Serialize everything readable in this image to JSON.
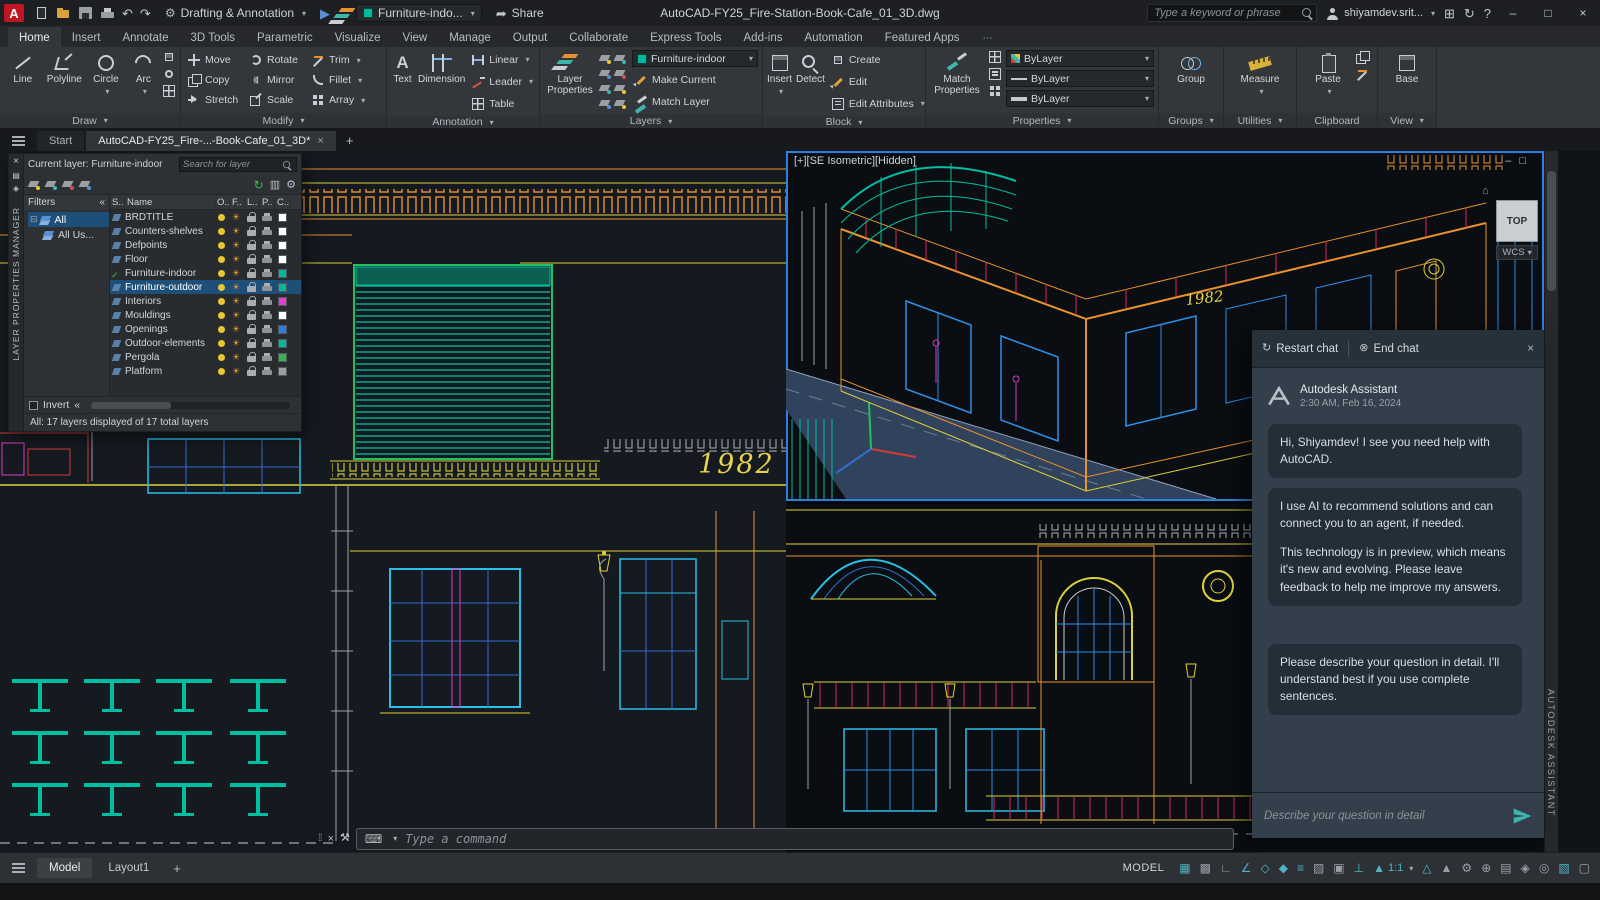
{
  "titlebar": {
    "workspace": "Drafting & Annotation",
    "quick_layer": "Furniture-indo...",
    "share": "Share",
    "doc_title": "AutoCAD-FY25_Fire-Station-Book-Cafe_01_3D.dwg",
    "search_placeholder": "Type a keyword or phrase",
    "account": "shiyamdev.srit..."
  },
  "ribbon": {
    "tabs": [
      "Home",
      "Insert",
      "Annotate",
      "3D Tools",
      "Parametric",
      "Visualize",
      "View",
      "Manage",
      "Output",
      "Collaborate",
      "Express Tools",
      "Add-ins",
      "Automation",
      "Featured Apps"
    ],
    "active_tab": "Home",
    "draw": {
      "line": "Line",
      "polyline": "Polyline",
      "circle": "Circle",
      "arc": "Arc",
      "label": "Draw"
    },
    "modify": {
      "move": "Move",
      "rotate": "Rotate",
      "trim": "Trim",
      "copy": "Copy",
      "mirror": "Mirror",
      "fillet": "Fillet",
      "stretch": "Stretch",
      "scale": "Scale",
      "array": "Array",
      "label": "Modify"
    },
    "annotation": {
      "text": "Text",
      "dimension": "Dimension",
      "linear": "Linear",
      "leader": "Leader",
      "table": "Table",
      "label": "Annotation"
    },
    "layers": {
      "layer_properties": "Layer Properties",
      "combo_value": "Furniture-indoor",
      "make_current": "Make Current",
      "match_layer": "Match Layer",
      "label": "Layers"
    },
    "block": {
      "insert": "Insert",
      "detect": "Detect",
      "create": "Create",
      "edit": "Edit",
      "edit_attributes": "Edit Attributes",
      "label": "Block"
    },
    "properties": {
      "match_properties": "Match Properties",
      "color_value": "ByLayer",
      "linetype_value": "ByLayer",
      "lineweight_value": "ByLayer",
      "label": "Properties"
    },
    "groups": {
      "group": "Group",
      "label": "Groups"
    },
    "utilities": {
      "measure": "Measure",
      "label": "Utilities"
    },
    "clipboard": {
      "paste": "Paste",
      "label": "Clipboard"
    },
    "view": {
      "base": "Base",
      "label": "View"
    }
  },
  "doc_tabs": {
    "start": "Start",
    "active": "AutoCAD-FY25_Fire-...-Book-Cafe_01_3D*"
  },
  "layer_palette": {
    "vertical_title": "LAYER PROPERTIES MANAGER",
    "current_layer": "Current layer: Furniture-indoor",
    "search_placeholder": "Search for layer",
    "filters_label": "Filters",
    "tree": [
      "All",
      "All Us..."
    ],
    "columns": [
      "S..",
      "Name",
      "O..",
      "F..",
      "L..",
      "P..",
      "C.."
    ],
    "rows": [
      {
        "name": "BRDTITLE",
        "color": "#ffffff"
      },
      {
        "name": "Counters-shelves",
        "color": "#ffffff"
      },
      {
        "name": "Defpoints",
        "color": "#ffffff"
      },
      {
        "name": "Floor",
        "color": "#ffffff"
      },
      {
        "name": "Furniture-indoor",
        "color": "#00b89c",
        "current": true
      },
      {
        "name": "Furniture-outdoor",
        "color": "#00b89c",
        "selected": true
      },
      {
        "name": "Interiors",
        "color": "#e13fd2"
      },
      {
        "name": "Mouldings",
        "color": "#ffffff"
      },
      {
        "name": "Openings",
        "color": "#2f7bdb"
      },
      {
        "name": "Outdoor-elements",
        "color": "#00b89c"
      },
      {
        "name": "Pergola",
        "color": "#35b44a"
      },
      {
        "name": "Platform",
        "color": "#9aa0a6"
      }
    ],
    "invert_label": "Invert",
    "status": "All: 17 layers displayed of 17 total layers"
  },
  "viewport": {
    "top_label": "[+][SE Isometric][Hidden]",
    "sign_text": "1982",
    "viewcube_top": "TOP",
    "wcs": "WCS"
  },
  "assistant": {
    "vertical_title": "AUTODESK ASSISTANT",
    "restart": "Restart chat",
    "end": "End chat",
    "bot_name": "Autodesk Assistant",
    "timestamp": "2:30 AM, Feb 16, 2024",
    "messages": [
      [
        "Hi, Shiyamdev! I see you need help with AutoCAD."
      ],
      [
        "I use AI to recommend solutions and can connect you to an agent, if needed.",
        "This technology is in preview, which means it's new and evolving. Please leave feedback to help me improve my answers."
      ],
      [
        "Please describe your question in detail. I'll understand best if you use complete sentences."
      ]
    ],
    "input_placeholder": "Describe your question in detail"
  },
  "command_line": {
    "placeholder": "Type a command"
  },
  "status_bar": {
    "model_tab": "Model",
    "layout_tab": "Layout1",
    "model_badge": "MODEL",
    "scale": "1:1",
    "icons_left": [
      {
        "name": "grid",
        "glyph": "▦",
        "on": true
      },
      {
        "name": "snap-mode",
        "glyph": "▩",
        "on": false
      },
      {
        "name": "ortho",
        "glyph": "∟",
        "on": false
      },
      {
        "name": "polar-tracking",
        "glyph": "∠",
        "on": true
      },
      {
        "name": "isodraft",
        "glyph": "◇",
        "on": true
      },
      {
        "name": "object-snap",
        "glyph": "◆",
        "on": true
      },
      {
        "name": "lineweight",
        "glyph": "≡",
        "on": true
      },
      {
        "name": "transparency",
        "glyph": "▨",
        "on": false
      },
      {
        "name": "selection-cycling",
        "glyph": "▣",
        "on": false
      },
      {
        "name": "dynamic-ucs",
        "glyph": "⊥",
        "on": true
      }
    ],
    "icons_right": [
      {
        "name": "annotation-visibility",
        "glyph": "△",
        "on": true
      },
      {
        "name": "autoscale",
        "glyph": "▲",
        "on": false
      },
      {
        "name": "workspace-switching",
        "glyph": "⚙",
        "on": false
      },
      {
        "name": "annotation-monitor",
        "glyph": "⊕",
        "on": false
      },
      {
        "name": "quick-properties",
        "glyph": "▤",
        "on": false
      },
      {
        "name": "lock-ui",
        "glyph": "◈",
        "on": false
      },
      {
        "name": "isolate-objects",
        "glyph": "◎",
        "on": false
      },
      {
        "name": "graphics-performance",
        "glyph": "▧",
        "on": true
      },
      {
        "name": "clean-screen",
        "glyph": "▢",
        "on": false
      }
    ]
  },
  "colors": {
    "accent_blue": "#2f7fe0",
    "teal": "#00bfa0",
    "yellow": "#ded23a",
    "orange": "#e8922e",
    "cyan": "#27c0e8",
    "blue": "#2f8fe8",
    "magenta": "#e038c8",
    "crimson": "#e0285a",
    "red": "#d43a3a",
    "assistant_teal": "#3fb6ad"
  }
}
